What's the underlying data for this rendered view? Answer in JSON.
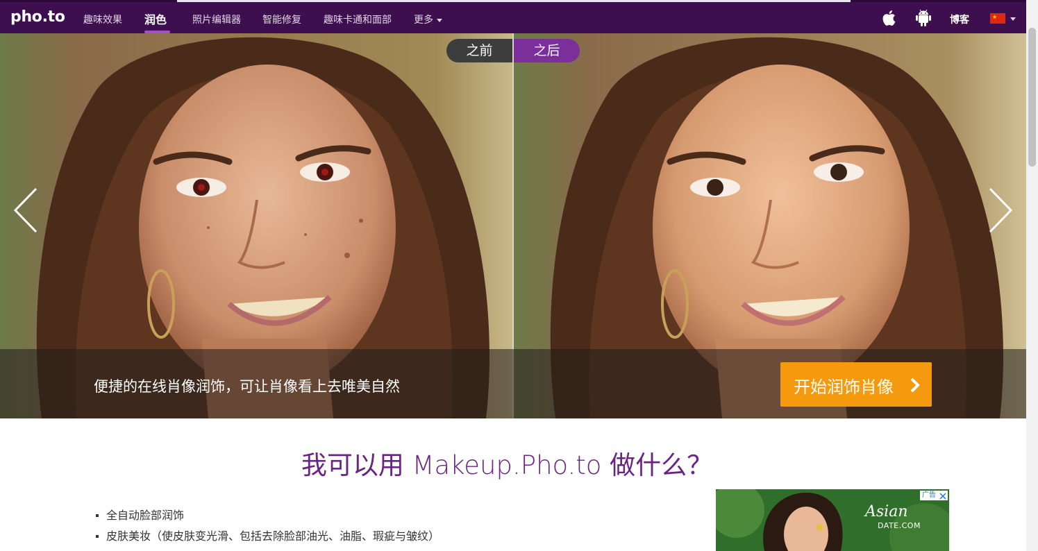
{
  "app": {
    "logo": "pho.to"
  },
  "nav": {
    "items": [
      {
        "label": "趣味效果"
      },
      {
        "label": "润色"
      },
      {
        "label": "照片编辑器"
      },
      {
        "label": "智能修复"
      },
      {
        "label": "趣味卡通和面部"
      },
      {
        "label": "更多"
      }
    ],
    "active_index": 1,
    "right": {
      "apple_icon": "apple-icon",
      "android_icon": "android-icon",
      "blog_label": "博客",
      "language_flag": "china-flag-icon"
    }
  },
  "hero": {
    "toggle": {
      "before_label": "之前",
      "after_label": "之后",
      "selected": "after"
    },
    "caption": "便捷的在线肖像润饰，可让肖像看上去唯美自然",
    "cta_label": "开始润饰肖像",
    "prev_icon": "chevron-left-icon",
    "next_icon": "chevron-right-icon"
  },
  "content": {
    "title": "我可以用 Makeup.Pho.to 做什么？",
    "features": [
      "全自动脸部润饰",
      "皮肤美妆（使皮肤变光滑、包括去除脸部油光、油脂、瑕疵与皱纹）"
    ]
  },
  "ad": {
    "badge_label": "广告",
    "brand": "Asian",
    "brand_sub": "DATE.COM"
  },
  "colors": {
    "nav_bg": "#3e0f4f",
    "accent_purple": "#7b2f9b",
    "title_purple": "#6a2582",
    "cta_orange": "#f59a0f"
  }
}
